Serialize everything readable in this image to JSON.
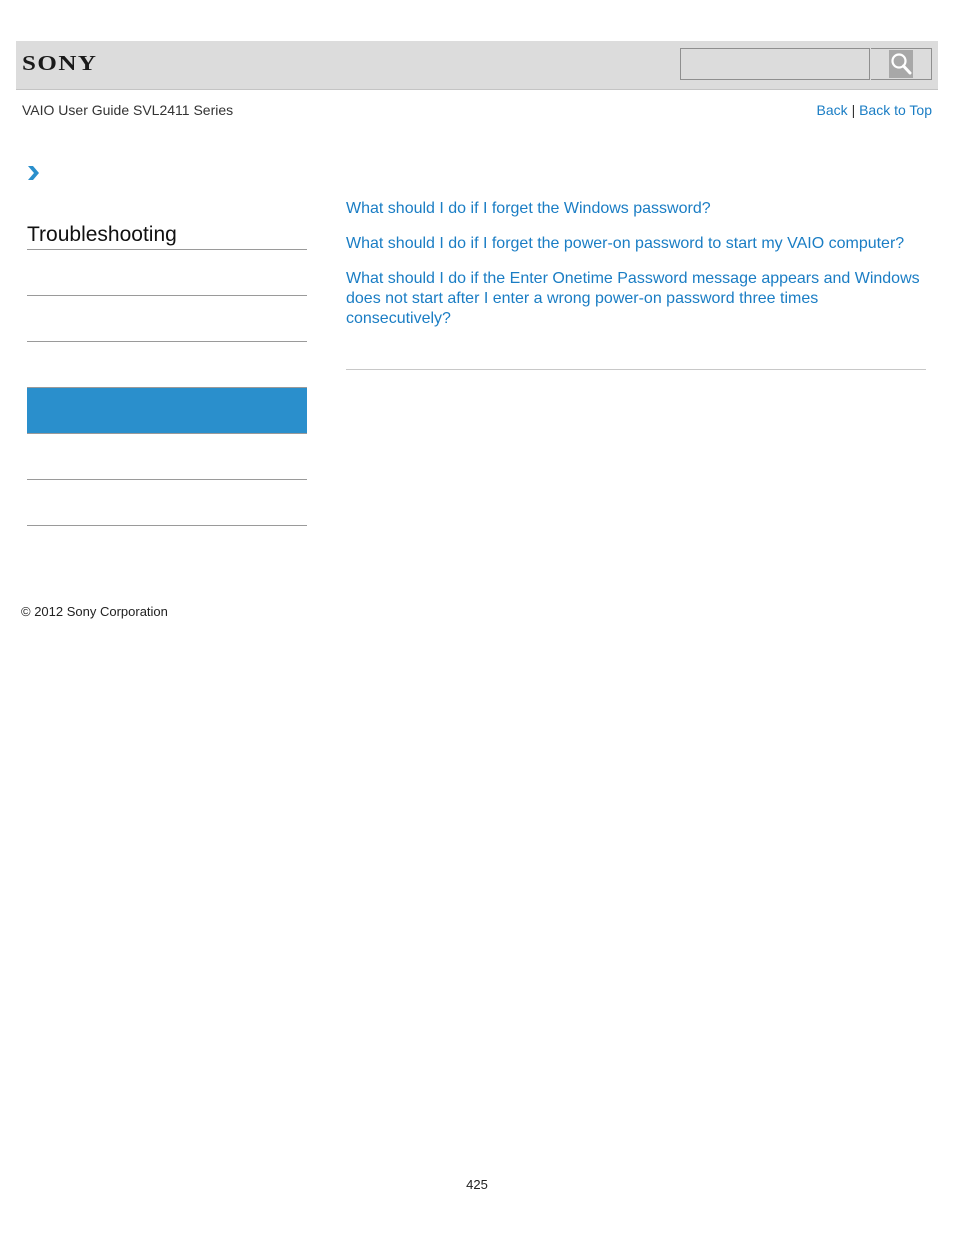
{
  "header": {
    "logo": "SONY",
    "search": {
      "value": "",
      "placeholder": ""
    },
    "search_icon": "magnifier-icon"
  },
  "subheader": {
    "guide_title": "VAIO User Guide SVL2411 Series",
    "back_label": "Back",
    "separator": "|",
    "back_to_top_label": "Back to Top"
  },
  "breadcrumb": {
    "icon": "chevron-right-icon"
  },
  "sidebar": {
    "title": "Troubleshooting",
    "items": [
      {
        "label": "",
        "active": false
      },
      {
        "label": "",
        "active": false
      },
      {
        "label": "",
        "active": false
      },
      {
        "label": "",
        "active": true
      },
      {
        "label": "",
        "active": false
      },
      {
        "label": "",
        "active": false
      }
    ]
  },
  "content": {
    "links": [
      "What should I do if I forget the Windows password?",
      "What should I do if I forget the power-on password to start my VAIO computer?",
      "What should I do if the Enter Onetime Password message appears and Windows does not start after I enter a wrong power-on password three times consecutively?"
    ]
  },
  "footer": {
    "copyright": "© 2012 Sony Corporation",
    "page_number": "425"
  },
  "colors": {
    "link": "#1a7dc4",
    "active_sidebar": "#2a8fcc",
    "header_bg": "#dcdcdc"
  }
}
